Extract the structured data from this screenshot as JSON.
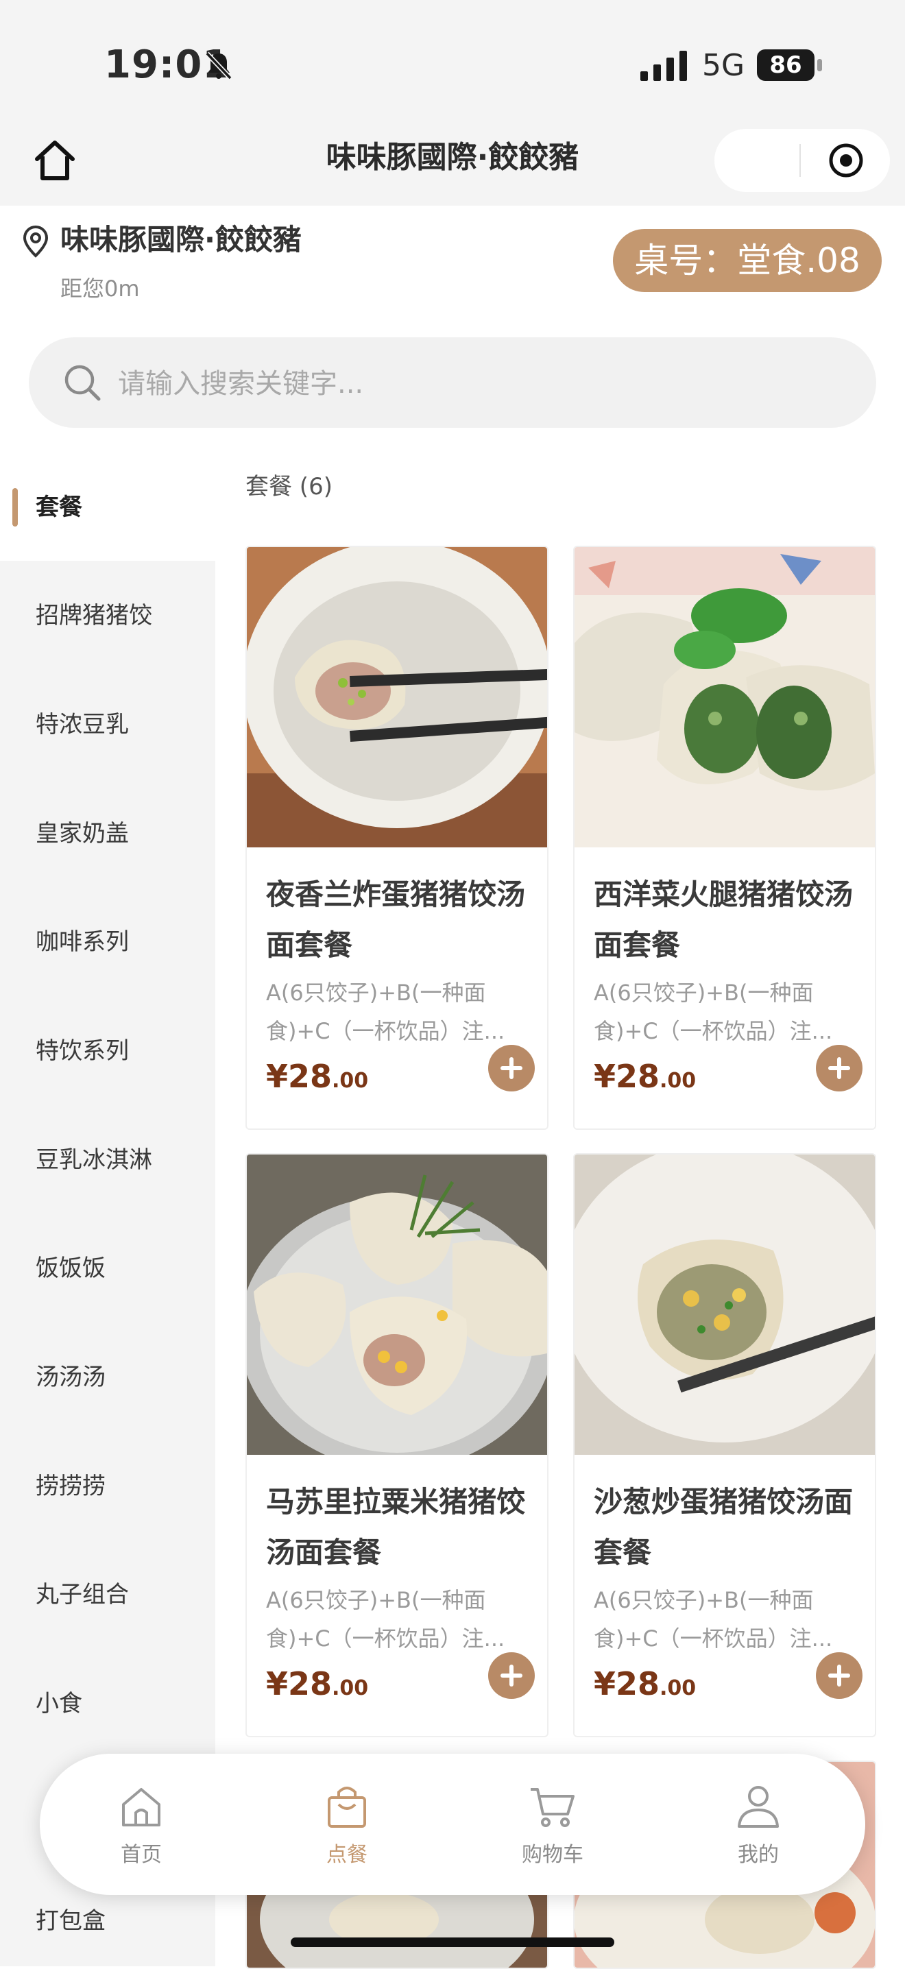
{
  "status_bar": {
    "time": "19:01",
    "network": "5G",
    "battery": "86"
  },
  "nav": {
    "title": "味味豚國際·餃餃豬"
  },
  "store": {
    "name": "味味豚國際·餃餃豬",
    "distance": "距您0m",
    "table": "桌号：堂食.08"
  },
  "search": {
    "placeholder": "请输入搜索关键字..."
  },
  "sidebar": {
    "items": [
      {
        "label": "套餐",
        "active": true
      },
      {
        "label": "招牌猪猪饺"
      },
      {
        "label": "特浓豆乳"
      },
      {
        "label": "皇家奶盖"
      },
      {
        "label": "咖啡系列"
      },
      {
        "label": "特饮系列"
      },
      {
        "label": "豆乳冰淇淋"
      },
      {
        "label": "饭饭饭"
      },
      {
        "label": "汤汤汤"
      },
      {
        "label": "捞捞捞"
      },
      {
        "label": "丸子组合"
      },
      {
        "label": "小食"
      },
      {
        "label": "打包盒"
      }
    ]
  },
  "category": {
    "header": "套餐 (6)"
  },
  "products": [
    {
      "title": "夜香兰炸蛋猪猪饺汤面套餐",
      "desc": "A(6只饺子)+B(一种面食)+C（一杯饮品）注...",
      "price_main": "¥28",
      "price_decimal": ".00"
    },
    {
      "title": "西洋菜火腿猪猪饺汤面套餐",
      "desc": "A(6只饺子)+B(一种面食)+C（一杯饮品）注...",
      "price_main": "¥28",
      "price_decimal": ".00"
    },
    {
      "title": "马苏里拉粟米猪猪饺汤面套餐",
      "desc": "A(6只饺子)+B(一种面食)+C（一杯饮品）注...",
      "price_main": "¥28",
      "price_decimal": ".00"
    },
    {
      "title": "沙葱炒蛋猪猪饺汤面套餐",
      "desc": "A(6只饺子)+B(一种面食)+C（一杯饮品）注...",
      "price_main": "¥28",
      "price_decimal": ".00"
    }
  ],
  "tabbar": {
    "items": [
      {
        "label": "首页",
        "icon": "home-icon"
      },
      {
        "label": "点餐",
        "icon": "shopping-bag-icon",
        "active": true
      },
      {
        "label": "购物车",
        "icon": "cart-icon"
      },
      {
        "label": "我的",
        "icon": "user-icon"
      }
    ]
  },
  "colors": {
    "accent": "#c49870",
    "price": "#7a3616",
    "sidebar_bg": "#f4f4f4"
  }
}
